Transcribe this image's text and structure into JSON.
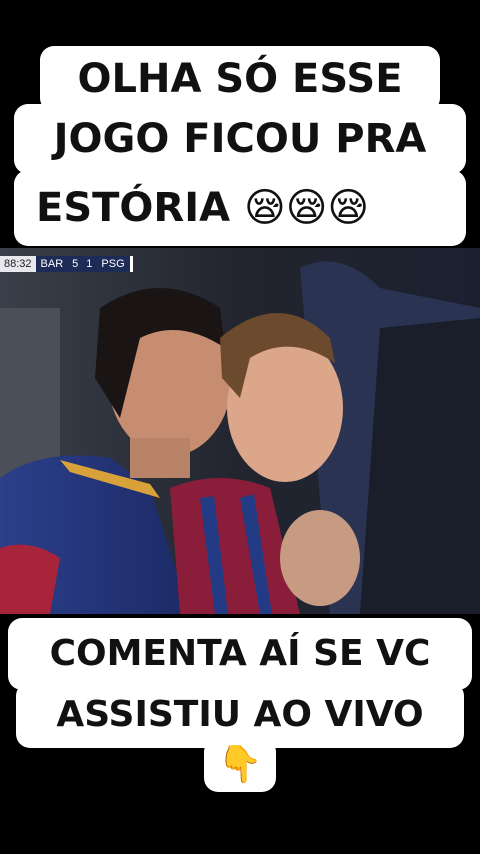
{
  "top_caption": {
    "line1": "OLHA SÓ ESSE",
    "line2": "JOGO FICOU PRA",
    "line3": "ESTÓRIA 😪😪😪"
  },
  "scoreboard": {
    "clock": "88:32",
    "home_team": "BAR",
    "home_score": "5",
    "away_score": "1",
    "away_team": "PSG"
  },
  "bottom_caption": {
    "line1": "COMENTA AÍ SE VC",
    "line2": "ASSISTIU AO VIVO",
    "line3": "👇"
  }
}
